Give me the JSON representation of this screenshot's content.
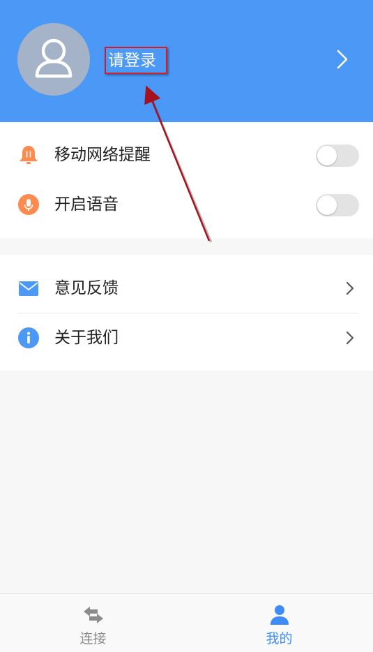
{
  "header": {
    "login_label": "请登录",
    "background_color": "#4b98f7"
  },
  "settings": {
    "items": [
      {
        "label": "移动网络提醒",
        "icon": "bell-icon",
        "toggle_on": false,
        "icon_color": "#ff8a4f"
      },
      {
        "label": "开启语音",
        "icon": "microphone-icon",
        "toggle_on": false,
        "icon_color": "#ff8a4f"
      }
    ]
  },
  "links": {
    "items": [
      {
        "label": "意见反馈",
        "icon": "mail-icon",
        "icon_color": "#4b98f7"
      },
      {
        "label": "关于我们",
        "icon": "info-icon",
        "icon_color": "#4b98f7"
      }
    ]
  },
  "tabbar": {
    "tabs": [
      {
        "label": "连接",
        "icon": "swap-arrows-icon",
        "active": false
      },
      {
        "label": "我的",
        "icon": "person-icon",
        "active": true
      }
    ],
    "active_color": "#3e8cf5",
    "inactive_color": "#8c8c8c"
  },
  "annotation": {
    "highlight_color": "#cc1f2a",
    "arrow_color": "#a5121e"
  }
}
